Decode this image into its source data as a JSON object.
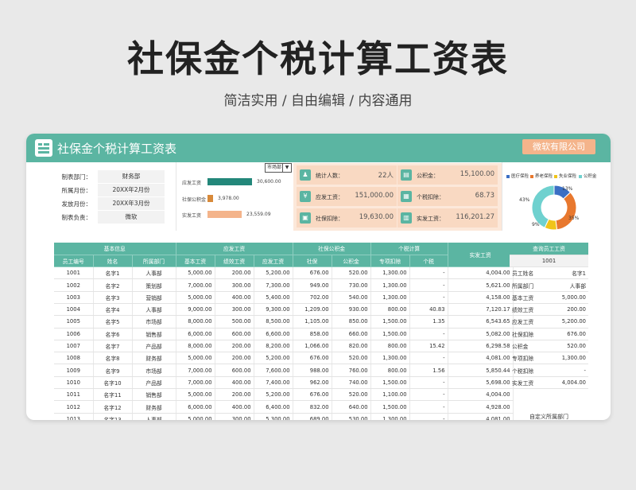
{
  "hero": {
    "title": "社保金个税计算工资表",
    "subtitle": "简洁实用 / 自由编辑 / 内容通用"
  },
  "header": {
    "title": "社保金个税计算工资表",
    "company": "微软有限公司"
  },
  "info": [
    {
      "label": "制表部门：",
      "value": "财务部"
    },
    {
      "label": "所属月份：",
      "value": "20XX年2月份"
    },
    {
      "label": "发放月份：",
      "value": "20XX年3月份"
    },
    {
      "label": "制表负责：",
      "value": "微软"
    }
  ],
  "dept_filter": {
    "selected": "市场部",
    "arrow": "▼"
  },
  "bars": [
    {
      "label": "应发工资",
      "value": 30600,
      "value_text": "30,600.00",
      "color": "#23877a"
    },
    {
      "label": "社保公积金",
      "value": 3978,
      "value_text": "3,978.00",
      "color": "#d88a3a"
    },
    {
      "label": "实发工资",
      "value": 23559.09,
      "value_text": "23,559.09",
      "color": "#f4b48b"
    }
  ],
  "stats": [
    {
      "label": "统计人数：",
      "value": "22人",
      "icon": "people-icon",
      "glyph": "♟"
    },
    {
      "label": "公积金：",
      "value": "15,100.00",
      "icon": "wallet-icon",
      "glyph": "▤"
    },
    {
      "label": "应发工资：",
      "value": "151,000.00",
      "icon": "money-icon",
      "glyph": "¥"
    },
    {
      "label": "个税扣除：",
      "value": "68.73",
      "icon": "tax-icon",
      "glyph": "▦"
    },
    {
      "label": "社保扣除：",
      "value": "19,630.00",
      "icon": "shield-icon",
      "glyph": "▣"
    },
    {
      "label": "实发工资：",
      "value": "116,201.27",
      "icon": "payroll-icon",
      "glyph": "▥"
    }
  ],
  "donut": {
    "legend": [
      {
        "name": "医疗保险",
        "color": "#3b6fc4"
      },
      {
        "name": "养老保险",
        "color": "#e8782e"
      },
      {
        "name": "失业保险",
        "color": "#f0c419"
      },
      {
        "name": "公积金",
        "color": "#6fd1cf"
      }
    ],
    "slices": [
      {
        "pct": 13,
        "label": "13%",
        "color": "#3b6fc4"
      },
      {
        "pct": 35,
        "label": "35%",
        "color": "#e8782e"
      },
      {
        "pct": 9,
        "label": "9%",
        "color": "#f0c419"
      },
      {
        "pct": 43,
        "label": "43%",
        "color": "#6fd1cf"
      }
    ]
  },
  "table": {
    "groups": [
      {
        "label": "基本信息",
        "span": 3
      },
      {
        "label": "应发工资",
        "span": 3
      },
      {
        "label": "社保公积金",
        "span": 2
      },
      {
        "label": "个税计算",
        "span": 2
      }
    ],
    "last_group": "实发工资",
    "columns": [
      "员工编号",
      "姓名",
      "所属部门",
      "基本工资",
      "绩效工资",
      "应发工资",
      "社保",
      "公积金",
      "专项扣除",
      "个税"
    ],
    "rows": [
      [
        "1001",
        "名字1",
        "人事部",
        "5,000.00",
        "200.00",
        "5,200.00",
        "676.00",
        "520.00",
        "1,300.00",
        "-",
        "4,004.00"
      ],
      [
        "1002",
        "名字2",
        "策划部",
        "7,000.00",
        "300.00",
        "7,300.00",
        "949.00",
        "730.00",
        "1,300.00",
        "-",
        "5,621.00"
      ],
      [
        "1003",
        "名字3",
        "营销部",
        "5,000.00",
        "400.00",
        "5,400.00",
        "702.00",
        "540.00",
        "1,300.00",
        "-",
        "4,158.00"
      ],
      [
        "1004",
        "名字4",
        "人事部",
        "9,000.00",
        "300.00",
        "9,300.00",
        "1,209.00",
        "930.00",
        "800.00",
        "40.83",
        "7,120.17"
      ],
      [
        "1005",
        "名字5",
        "市场部",
        "8,000.00",
        "500.00",
        "8,500.00",
        "1,105.00",
        "850.00",
        "1,500.00",
        "1.35",
        "6,543.65"
      ],
      [
        "1006",
        "名字6",
        "销售部",
        "6,000.00",
        "600.00",
        "6,600.00",
        "858.00",
        "660.00",
        "1,500.00",
        "-",
        "5,082.00"
      ],
      [
        "1007",
        "名字7",
        "产品部",
        "8,000.00",
        "200.00",
        "8,200.00",
        "1,066.00",
        "820.00",
        "800.00",
        "15.42",
        "6,298.58"
      ],
      [
        "1008",
        "名字8",
        "财务部",
        "5,000.00",
        "200.00",
        "5,200.00",
        "676.00",
        "520.00",
        "1,300.00",
        "-",
        "4,081.00"
      ],
      [
        "1009",
        "名字9",
        "市场部",
        "7,000.00",
        "600.00",
        "7,600.00",
        "988.00",
        "760.00",
        "800.00",
        "1.56",
        "5,850.44"
      ],
      [
        "1010",
        "名字10",
        "产品部",
        "7,000.00",
        "400.00",
        "7,400.00",
        "962.00",
        "740.00",
        "1,500.00",
        "-",
        "5,698.00"
      ],
      [
        "1011",
        "名字11",
        "销售部",
        "5,000.00",
        "200.00",
        "5,200.00",
        "676.00",
        "520.00",
        "1,100.00",
        "-",
        "4,004.00"
      ],
      [
        "1012",
        "名字12",
        "财务部",
        "6,000.00",
        "400.00",
        "6,400.00",
        "832.00",
        "640.00",
        "1,500.00",
        "-",
        "4,928.00"
      ],
      [
        "1013",
        "名字13",
        "人事部",
        "5,000.00",
        "300.00",
        "5,300.00",
        "689.00",
        "530.00",
        "1,300.00",
        "-",
        "4,081.00"
      ]
    ]
  },
  "lookup": {
    "title": "查询员工工资",
    "id": "1001",
    "rows": [
      [
        "员工姓名",
        "名字1"
      ],
      [
        "所属部门",
        "人事部"
      ],
      [
        "基本工资",
        "5,000.00"
      ],
      [
        "绩效工资",
        "200.00"
      ],
      [
        "应发工资",
        "5,200.00"
      ],
      [
        "社保扣除",
        "676.00"
      ],
      [
        "公积金",
        "520.00"
      ],
      [
        "专项扣除",
        "1,300.00"
      ],
      [
        "个税扣除",
        "-"
      ],
      [
        "实发工资",
        "4,004.00"
      ]
    ],
    "footer": "自定义所属部门"
  }
}
